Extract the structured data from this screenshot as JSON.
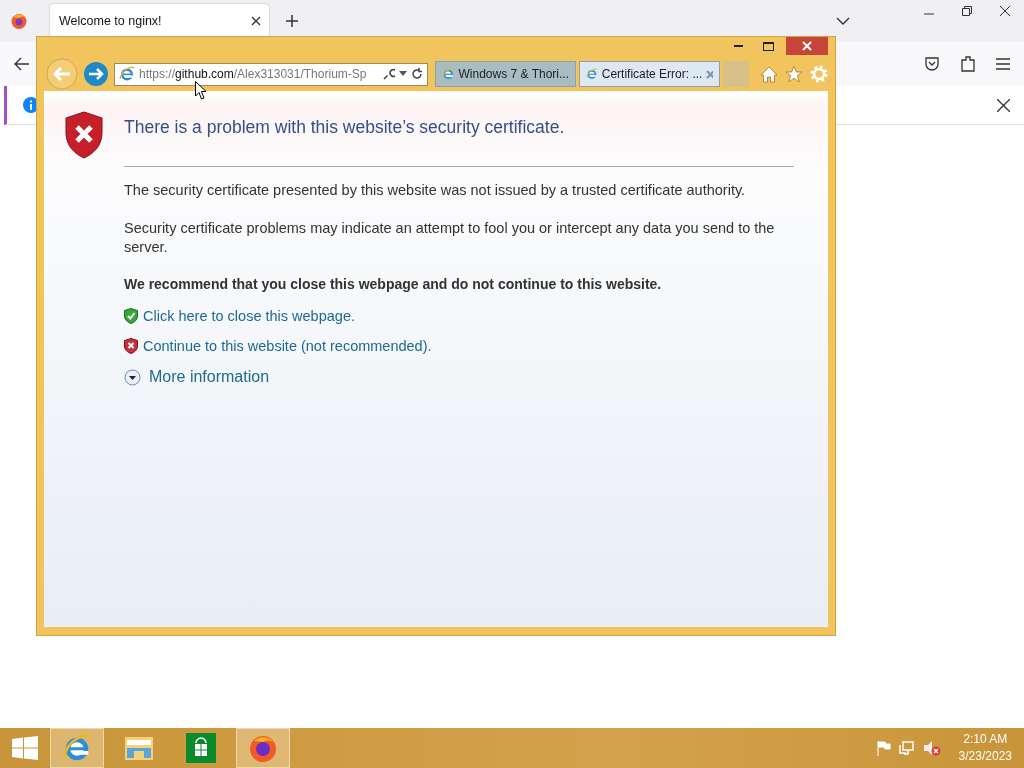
{
  "firefox": {
    "tabs": [
      {
        "label": "Welcome to nginx!",
        "selected": true
      }
    ]
  },
  "ie": {
    "address": {
      "scheme": "https://",
      "host": "github.com",
      "path": "/Alex313031/Thorium-Sp"
    },
    "tabs": [
      {
        "label": "Windows 7 & Thori...",
        "selected": false
      },
      {
        "label": "Certificate Error: ...",
        "selected": true
      }
    ],
    "heading": "There is a problem with this website’s security certificate.",
    "paragraphs": [
      "The security certificate presented by this website was not issued by a trusted certificate authority.",
      "Security certificate problems may indicate an attempt to fool you or intercept any data you send to the server."
    ],
    "recommendation": "We recommend that you close this webpage and do not continue to this website.",
    "actions": [
      {
        "kind": "safe",
        "label": "Click here to close this webpage."
      },
      {
        "kind": "unsafe",
        "label": "Continue to this website (not recommended)."
      }
    ],
    "more": "More information"
  },
  "taskbar": {
    "apps": [
      {
        "kind": "ie",
        "active": true
      },
      {
        "kind": "explorer",
        "active": false
      },
      {
        "kind": "store",
        "active": false
      },
      {
        "kind": "firefox",
        "active": true
      }
    ],
    "time": "2:10 AM",
    "date": "3/23/2023"
  }
}
